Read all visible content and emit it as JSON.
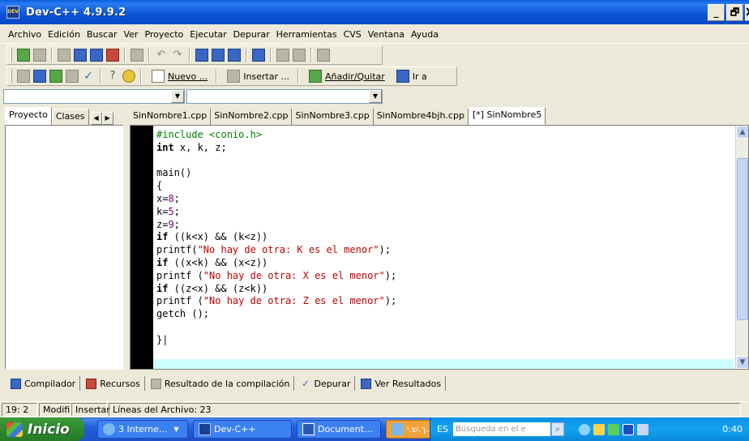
{
  "window": {
    "title": "Dev-C++ 4.9.9.2",
    "app_icon_text": "DEV",
    "min": "_",
    "max": "🗗",
    "close": "X"
  },
  "menu": [
    "Archivo",
    "Edición",
    "Buscar",
    "Ver",
    "Proyecto",
    "Ejecutar",
    "Depurar",
    "Herramientas",
    "CVS",
    "Ventana",
    "Ayuda"
  ],
  "toolbar2": {
    "nuevo": "Nuevo ...",
    "insertar": "Insertar ...",
    "anadir": "Añadir/Quitar",
    "ira": "Ir a"
  },
  "left_tabs": {
    "proyecto": "Proyecto",
    "clases": "Clases"
  },
  "editor_tabs": [
    "SinNombre1.cpp",
    "SinNombre2.cpp",
    "SinNombre3.cpp",
    "SinNombre4bjh.cpp",
    "[*] SinNombre5"
  ],
  "code": {
    "l1": "#include <conio.h>",
    "l2_kw": "int",
    "l2_rest": " x, k, z;",
    "l4": "main()",
    "l5": "{",
    "l6_a": "x=",
    "l6_n": "8",
    "l6_b": ";",
    "l7_a": "k=",
    "l7_n": "5",
    "l7_b": ";",
    "l8_a": "z=",
    "l8_n": "9",
    "l8_b": ";",
    "l9_kw": "if",
    "l9_rest": " ((k<x) && (k<z))",
    "l10_a": "printf(",
    "l10_s": "\"No hay de otra: K es el menor\"",
    "l10_b": ");",
    "l11_kw": "if",
    "l11_rest": " ((x<k) && (x<z))",
    "l12_a": "printf (",
    "l12_s": "\"No hay de otra: X es el menor\"",
    "l12_b": ");",
    "l13_kw": "if",
    "l13_rest": " ((z<x) && (z<k))",
    "l14_a": "printf (",
    "l14_s": "\"No hay de otra: Z es el menor\"",
    "l14_b": ");",
    "l15": "getch ();",
    "l17": "}|"
  },
  "bottom_tabs": {
    "compilador": "Compilador",
    "recursos": "Recursos",
    "resultado": "Resultado de la compilación",
    "depurar": "Depurar",
    "ver": "Ver Resultados"
  },
  "status": {
    "pos": "19: 2",
    "mod": "Modific",
    "ins": "Insertar",
    "lines": "Líneas del Archivo: 23"
  },
  "taskbar": {
    "start": "Inicio",
    "tasks": [
      "3 Interne...",
      "Dev-C++",
      "Document...",
      "ל.א.ך.ש.י..."
    ],
    "lang": "ES",
    "search_placeholder": "Búsqueda en el e",
    "clock": "0:40"
  }
}
